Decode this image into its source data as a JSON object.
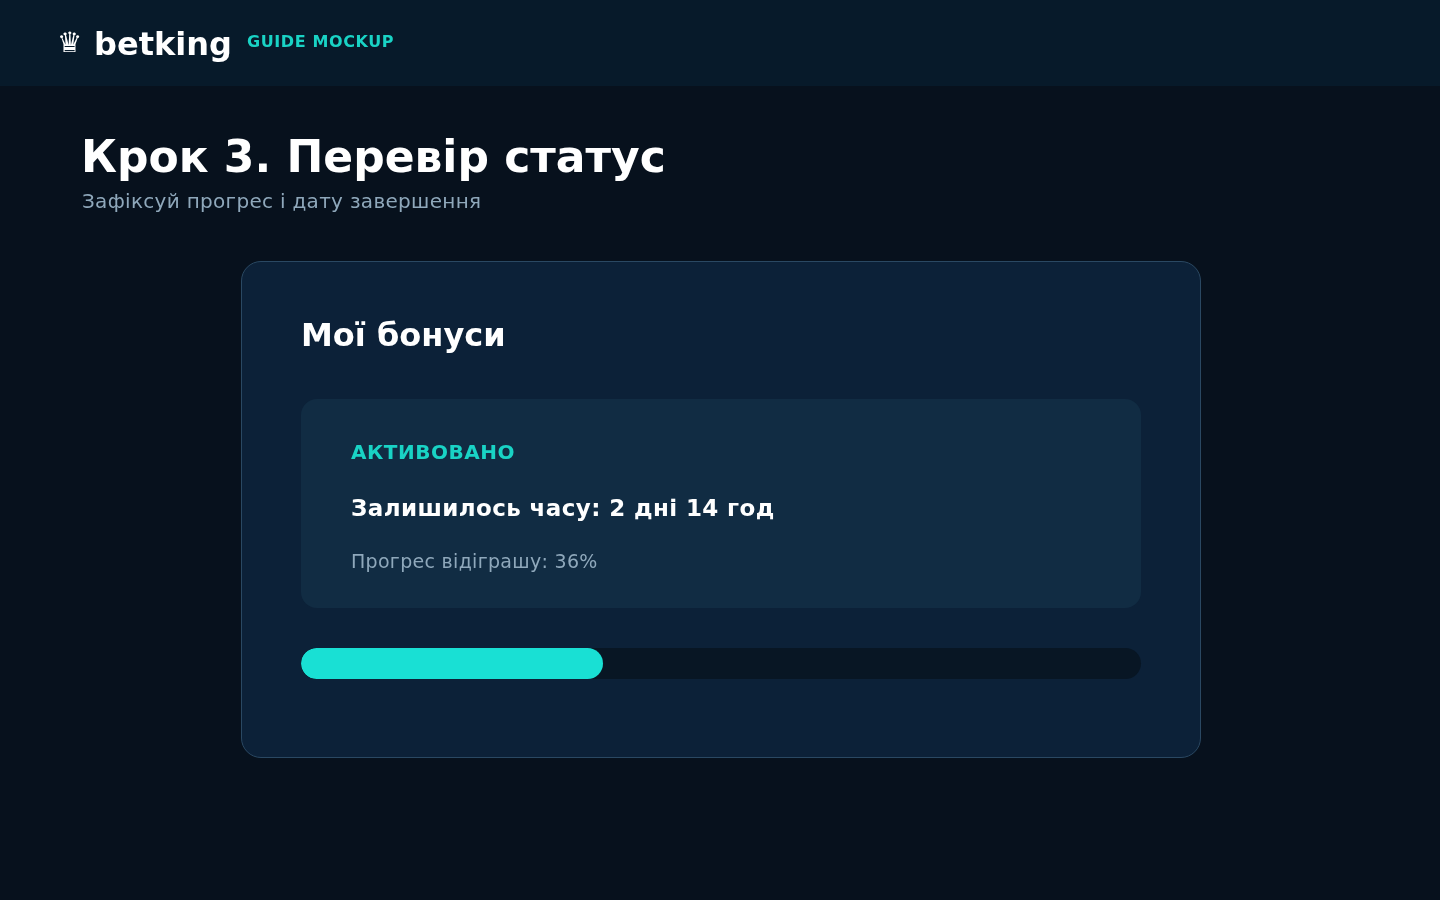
{
  "header": {
    "logo_icon": "♛",
    "brand": "betking",
    "tag": "GUIDE MOCKUP"
  },
  "page": {
    "title": "Крок 3. Перевір статус",
    "subtitle": "Зафіксуй прогрес і дату завершення"
  },
  "card": {
    "title": "Мої бонуси",
    "bonus": {
      "status": "АКТИВОВАНО",
      "time_left": "Залишилось часу: 2 дні 14 год",
      "progress_text": "Прогрес відіграшу: 36%"
    },
    "progress": {
      "level": 0.36
    }
  }
}
